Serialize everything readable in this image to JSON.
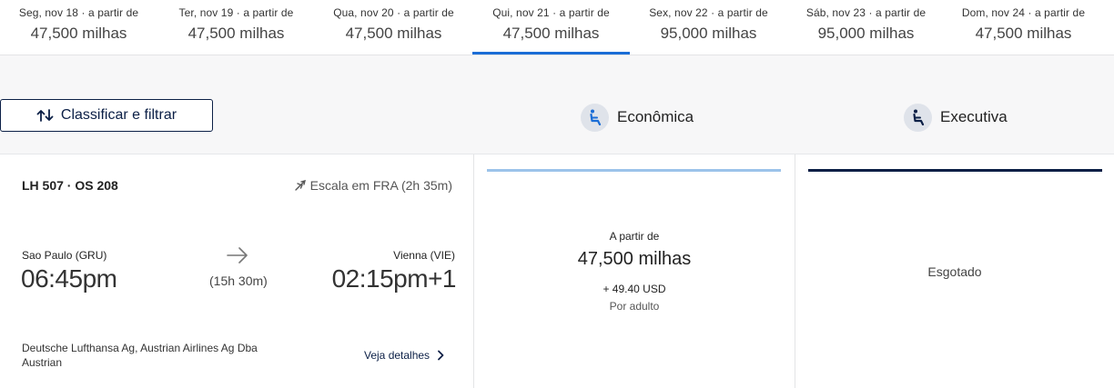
{
  "dates": [
    {
      "label": "Seg, nov 18 · a partir de",
      "price": "47,500 milhas",
      "selected": false
    },
    {
      "label": "Ter, nov 19 · a partir de",
      "price": "47,500 milhas",
      "selected": false
    },
    {
      "label": "Qua, nov 20 · a partir de",
      "price": "47,500 milhas",
      "selected": false
    },
    {
      "label": "Qui, nov 21 · a partir de",
      "price": "47,500 milhas",
      "selected": true
    },
    {
      "label": "Sex, nov 22 · a partir de",
      "price": "95,000 milhas",
      "selected": false
    },
    {
      "label": "Sáb, nov 23 · a partir de",
      "price": "95,000 milhas",
      "selected": false
    },
    {
      "label": "Dom, nov 24 · a partir de",
      "price": "47,500 milhas",
      "selected": false
    }
  ],
  "filter_button": {
    "label": "Classificar e filtrar",
    "icon": "sort-arrows-icon"
  },
  "cabins": {
    "economy": {
      "label": "Econômica",
      "icon": "seat-icon"
    },
    "business": {
      "label": "Executiva",
      "icon": "seat-icon"
    }
  },
  "flight": {
    "number": "LH 507 · OS 208",
    "stop": "Escala em FRA (2h 35m)",
    "origin_city": "Sao Paulo (GRU)",
    "origin_time": "06:45pm",
    "duration": "(15h 30m)",
    "dest_city": "Vienna (VIE)",
    "dest_time": "02:15pm+1",
    "carriers": "Deutsche Lufthansa Ag, Austrian Airlines Ag Dba Austrian",
    "details_label": "Veja detalhes"
  },
  "fares": {
    "economy": {
      "from": "A partir de",
      "miles": "47,500 milhas",
      "tax": "+ 49.40 USD",
      "per": "Por adulto"
    },
    "business": {
      "status": "Esgotado"
    }
  },
  "colors": {
    "accent": "#1a6dd6",
    "navy": "#0b1f46",
    "economy_bar": "#9cc3ea"
  }
}
